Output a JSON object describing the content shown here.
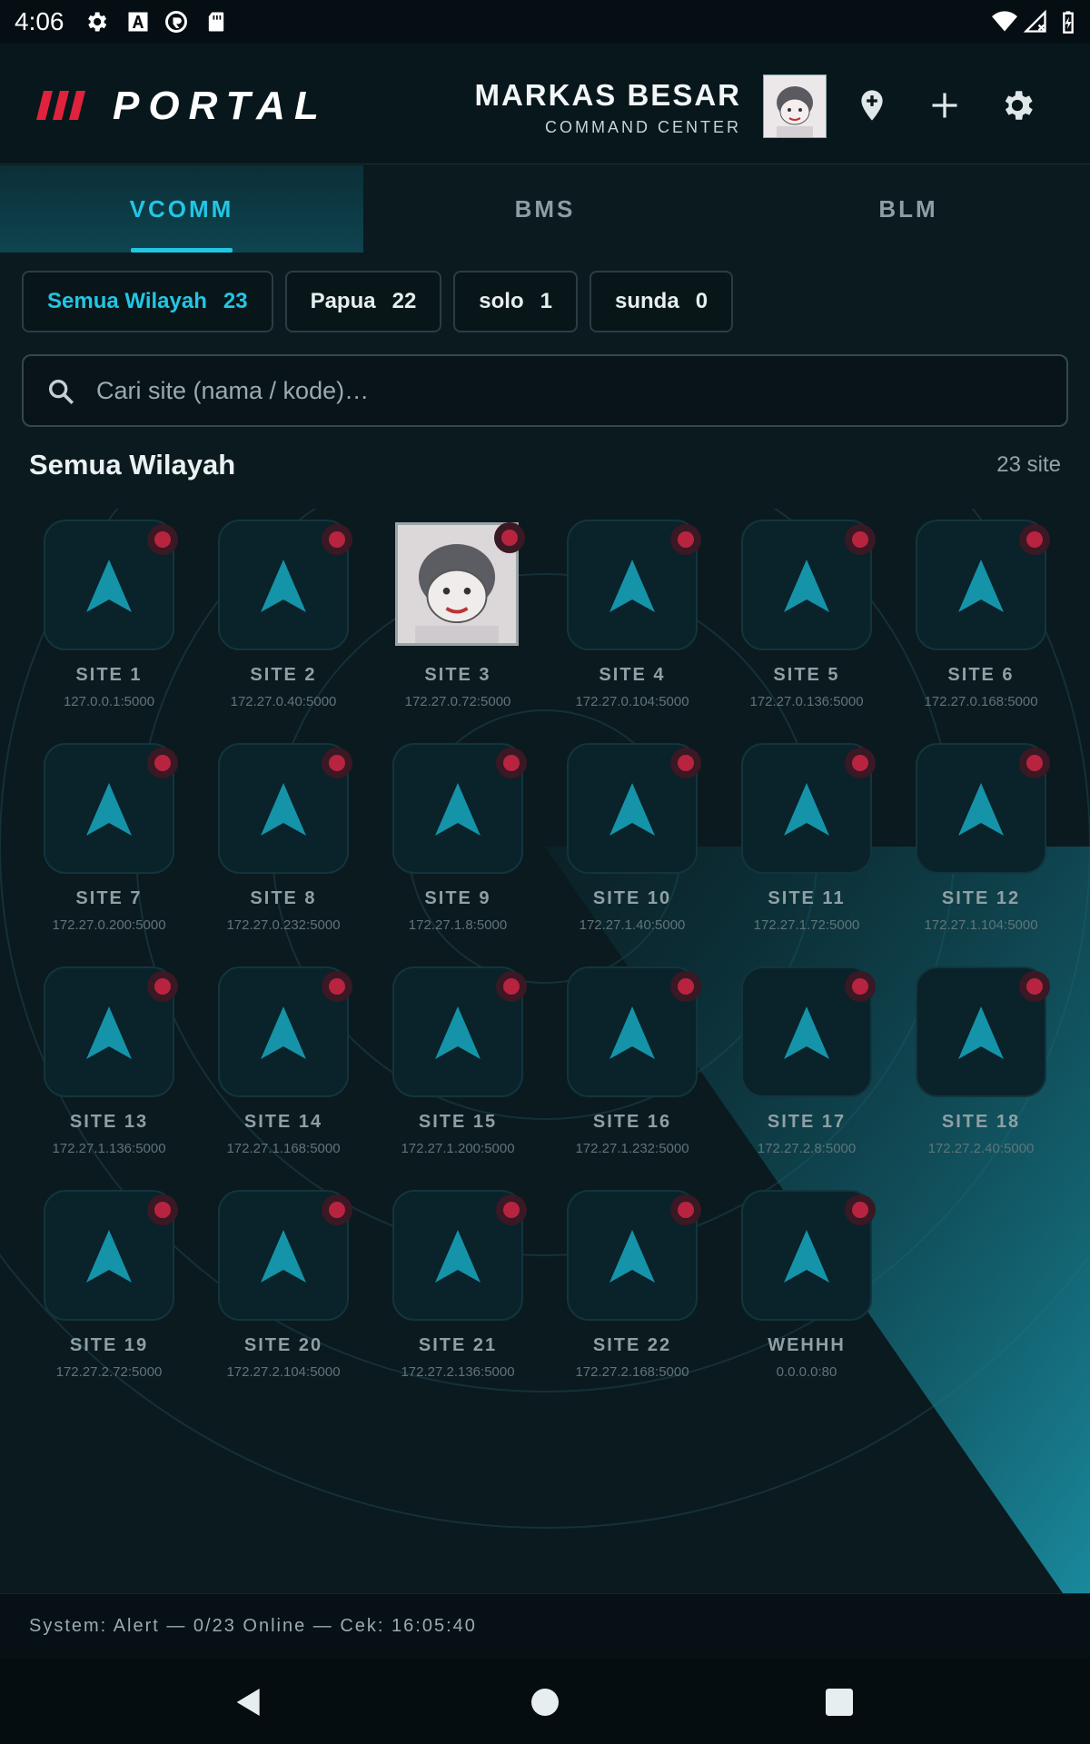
{
  "status_bar": {
    "time": "4:06"
  },
  "header": {
    "app_title": "PORTAL",
    "hq_title": "MARKAS BESAR",
    "hq_subtitle": "COMMAND CENTER"
  },
  "tabs": [
    {
      "label": "VCOMM",
      "active": true
    },
    {
      "label": "BMS",
      "active": false
    },
    {
      "label": "BLM",
      "active": false
    }
  ],
  "filters": [
    {
      "label": "Semua Wilayah",
      "count": "23",
      "active": true
    },
    {
      "label": "Papua",
      "count": "22",
      "active": false
    },
    {
      "label": "solo",
      "count": "1",
      "active": false
    },
    {
      "label": "sunda",
      "count": "0",
      "active": false
    }
  ],
  "search": {
    "placeholder": "Cari site (nama / kode)…",
    "value": ""
  },
  "section": {
    "title": "Semua Wilayah",
    "count": "23 site"
  },
  "sites": [
    {
      "name": "SITE 1",
      "address": "127.0.0.1:5000",
      "status": "offline",
      "icon": "navigation-arrow-icon"
    },
    {
      "name": "SITE 2",
      "address": "172.27.0.40:5000",
      "status": "offline",
      "icon": "navigation-arrow-icon"
    },
    {
      "name": "SITE 3",
      "address": "172.27.0.72:5000",
      "status": "offline",
      "icon": "photo-avatar"
    },
    {
      "name": "SITE 4",
      "address": "172.27.0.104:5000",
      "status": "offline",
      "icon": "navigation-arrow-icon"
    },
    {
      "name": "SITE 5",
      "address": "172.27.0.136:5000",
      "status": "offline",
      "icon": "navigation-arrow-icon"
    },
    {
      "name": "SITE 6",
      "address": "172.27.0.168:5000",
      "status": "offline",
      "icon": "navigation-arrow-icon"
    },
    {
      "name": "SITE 7",
      "address": "172.27.0.200:5000",
      "status": "offline",
      "icon": "navigation-arrow-icon"
    },
    {
      "name": "SITE 8",
      "address": "172.27.0.232:5000",
      "status": "offline",
      "icon": "navigation-arrow-icon"
    },
    {
      "name": "SITE 9",
      "address": "172.27.1.8:5000",
      "status": "offline",
      "icon": "navigation-arrow-icon"
    },
    {
      "name": "SITE 10",
      "address": "172.27.1.40:5000",
      "status": "offline",
      "icon": "navigation-arrow-icon"
    },
    {
      "name": "SITE 11",
      "address": "172.27.1.72:5000",
      "status": "offline",
      "icon": "navigation-arrow-icon"
    },
    {
      "name": "SITE 12",
      "address": "172.27.1.104:5000",
      "status": "offline",
      "icon": "navigation-arrow-icon"
    },
    {
      "name": "SITE 13",
      "address": "172.27.1.136:5000",
      "status": "offline",
      "icon": "navigation-arrow-icon"
    },
    {
      "name": "SITE 14",
      "address": "172.27.1.168:5000",
      "status": "offline",
      "icon": "navigation-arrow-icon"
    },
    {
      "name": "SITE 15",
      "address": "172.27.1.200:5000",
      "status": "offline",
      "icon": "navigation-arrow-icon"
    },
    {
      "name": "SITE 16",
      "address": "172.27.1.232:5000",
      "status": "offline",
      "icon": "navigation-arrow-icon"
    },
    {
      "name": "SITE 17",
      "address": "172.27.2.8:5000",
      "status": "offline",
      "icon": "navigation-arrow-icon"
    },
    {
      "name": "SITE 18",
      "address": "172.27.2.40:5000",
      "status": "offline",
      "icon": "navigation-arrow-icon"
    },
    {
      "name": "SITE 19",
      "address": "172.27.2.72:5000",
      "status": "offline",
      "icon": "navigation-arrow-icon"
    },
    {
      "name": "SITE 20",
      "address": "172.27.2.104:5000",
      "status": "offline",
      "icon": "navigation-arrow-icon"
    },
    {
      "name": "SITE 21",
      "address": "172.27.2.136:5000",
      "status": "offline",
      "icon": "navigation-arrow-icon"
    },
    {
      "name": "SITE 22",
      "address": "172.27.2.168:5000",
      "status": "offline",
      "icon": "navigation-arrow-icon"
    },
    {
      "name": "WEHHH",
      "address": "0.0.0.0:80",
      "status": "offline",
      "icon": "navigation-arrow-icon"
    }
  ],
  "footer": {
    "status_text": "System: Alert  —  0/23 Online  —  Cek: 16:05:40"
  },
  "colors": {
    "accent": "#22c6e3",
    "offline": "#b8243f",
    "background": "#0b1a1f"
  }
}
